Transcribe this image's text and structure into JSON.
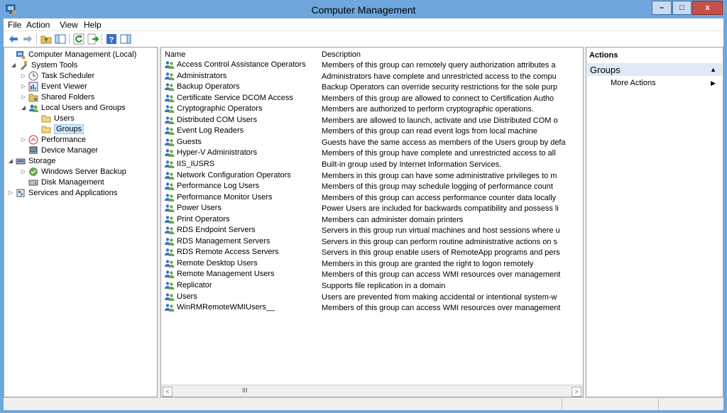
{
  "window": {
    "title": "Computer Management",
    "minimize_glyph": "–",
    "maximize_glyph": "□",
    "close_glyph": "x"
  },
  "menu": {
    "file": "File",
    "action": "Action",
    "view": "View",
    "help": "Help"
  },
  "toolbar": {
    "icons": [
      "back-icon",
      "forward-icon",
      "up-folder-icon",
      "show-hide-tree-icon",
      "refresh-icon",
      "export-list-icon",
      "help-icon",
      "show-hide-action-pane-icon"
    ]
  },
  "tree": {
    "items": [
      {
        "label": "Computer Management (Local)",
        "expander": "",
        "icon": "computer-management-icon"
      },
      {
        "label": "System Tools",
        "expander": "◢",
        "icon": "system-tools-icon"
      },
      {
        "label": "Task Scheduler",
        "expander": "▷",
        "icon": "task-scheduler-icon"
      },
      {
        "label": "Event Viewer",
        "expander": "▷",
        "icon": "event-viewer-icon"
      },
      {
        "label": "Shared Folders",
        "expander": "▷",
        "icon": "shared-folders-icon"
      },
      {
        "label": "Local Users and Groups",
        "expander": "◢",
        "icon": "local-users-groups-icon"
      },
      {
        "label": "Users",
        "expander": "",
        "icon": "folder-icon"
      },
      {
        "label": "Groups",
        "expander": "",
        "icon": "folder-open-icon"
      },
      {
        "label": "Performance",
        "expander": "▷",
        "icon": "performance-icon"
      },
      {
        "label": "Device Manager",
        "expander": "",
        "icon": "device-manager-icon"
      },
      {
        "label": "Storage",
        "expander": "◢",
        "icon": "storage-icon"
      },
      {
        "label": "Windows Server Backup",
        "expander": "▷",
        "icon": "windows-server-backup-icon"
      },
      {
        "label": "Disk Management",
        "expander": "",
        "icon": "disk-management-icon"
      },
      {
        "label": "Services and Applications",
        "expander": "▷",
        "icon": "services-applications-icon"
      }
    ]
  },
  "list": {
    "columns": {
      "name": "Name",
      "description": "Description"
    },
    "rows": [
      {
        "name": "Access Control Assistance Operators",
        "description": "Members of this group can remotely query authorization attributes a"
      },
      {
        "name": "Administrators",
        "description": "Administrators have complete and unrestricted access to the compu"
      },
      {
        "name": "Backup Operators",
        "description": "Backup Operators can override security restrictions for the sole purp"
      },
      {
        "name": "Certificate Service DCOM Access",
        "description": "Members of this group are allowed to connect to Certification Autho"
      },
      {
        "name": "Cryptographic Operators",
        "description": "Members are authorized to perform cryptographic operations."
      },
      {
        "name": "Distributed COM Users",
        "description": "Members are allowed to launch, activate and use Distributed COM o"
      },
      {
        "name": "Event Log Readers",
        "description": "Members of this group can read event logs from local machine"
      },
      {
        "name": "Guests",
        "description": "Guests have the same access as members of the Users group by defa"
      },
      {
        "name": "Hyper-V Administrators",
        "description": "Members of this group have complete and unrestricted access to all"
      },
      {
        "name": "IIS_IUSRS",
        "description": "Built-in group used by Internet Information Services."
      },
      {
        "name": "Network Configuration Operators",
        "description": "Members in this group can have some administrative privileges to m"
      },
      {
        "name": "Performance Log Users",
        "description": "Members of this group may schedule logging of performance count"
      },
      {
        "name": "Performance Monitor Users",
        "description": "Members of this group can access performance counter data locally"
      },
      {
        "name": "Power Users",
        "description": "Power Users are included for backwards compatibility and possess li"
      },
      {
        "name": "Print Operators",
        "description": "Members can administer domain printers"
      },
      {
        "name": "RDS Endpoint Servers",
        "description": "Servers in this group run virtual machines and host sessions where u"
      },
      {
        "name": "RDS Management Servers",
        "description": "Servers in this group can perform routine administrative actions on s"
      },
      {
        "name": "RDS Remote Access Servers",
        "description": "Servers in this group enable users of RemoteApp programs and pers"
      },
      {
        "name": "Remote Desktop Users",
        "description": "Members in this group are granted the right to logon remotely"
      },
      {
        "name": "Remote Management Users",
        "description": "Members of this group can access WMI resources over management"
      },
      {
        "name": "Replicator",
        "description": "Supports file replication in a domain"
      },
      {
        "name": "Users",
        "description": "Users are prevented from making accidental or intentional system-w"
      },
      {
        "name": "WinRMRemoteWMIUsers__",
        "description": "Members of this group can access WMI resources over management"
      }
    ],
    "scroll_left": "<",
    "scroll_right": ">",
    "scroll_grip": "III"
  },
  "actions": {
    "title": "Actions",
    "group_label": "Groups",
    "group_toggle": "▲",
    "more_actions": "More Actions",
    "more_arrow": "▶"
  },
  "colors": {
    "window_frame": "#6ea6dd",
    "selection": "#cde8ff",
    "close_button": "#c7504b"
  }
}
